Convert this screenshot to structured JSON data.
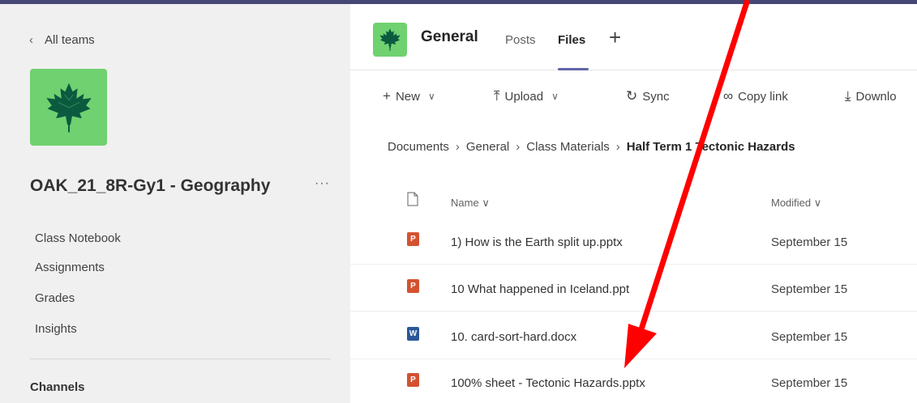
{
  "sidebar": {
    "back_label": "All teams",
    "team_name": "OAK_21_8R-Gy1 - Geography",
    "more": "···",
    "items": [
      {
        "label": "Class Notebook"
      },
      {
        "label": "Assignments"
      },
      {
        "label": "Grades"
      },
      {
        "label": "Insights"
      }
    ],
    "channels_heading": "Channels"
  },
  "header": {
    "channel_title": "General",
    "tabs": [
      {
        "label": "Posts",
        "active": false
      },
      {
        "label": "Files",
        "active": true
      }
    ],
    "add_tab": "+"
  },
  "toolbar": {
    "new_label": "New",
    "upload_label": "Upload",
    "sync_label": "Sync",
    "copy_link_label": "Copy link",
    "download_label": "Downlo"
  },
  "breadcrumb": {
    "items": [
      "Documents",
      "General",
      "Class Materials"
    ],
    "current": "Half Term 1 Tectonic Hazards"
  },
  "table": {
    "columns": {
      "name": "Name",
      "modified": "Modified"
    },
    "rows": [
      {
        "name": "1) How is the Earth split up.pptx",
        "modified": "September 15",
        "type": "pptx"
      },
      {
        "name": "10 What happened in Iceland.ppt",
        "modified": "September 15",
        "type": "ppt"
      },
      {
        "name": "10. card-sort-hard.docx",
        "modified": "September 15",
        "type": "docx"
      },
      {
        "name": "100% sheet - Tectonic Hazards.pptx",
        "modified": "September 15",
        "type": "pptx"
      }
    ]
  },
  "colors": {
    "accent": "#6264a7",
    "team_logo_bg": "#6fd170",
    "leaf": "#0b5a3f",
    "annotation_arrow": "#ff0000",
    "ppt_icon": "#d35230",
    "doc_icon": "#2b579a"
  },
  "icons": {
    "team_logo": "maple-leaf-icon",
    "file_ppt": "powerpoint-file-icon",
    "file_doc": "word-file-icon"
  }
}
